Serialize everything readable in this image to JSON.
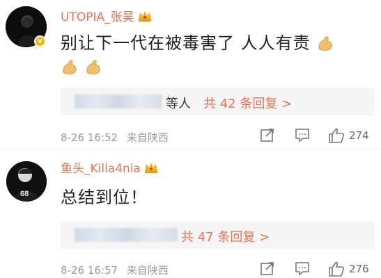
{
  "comments": [
    {
      "username": "UTOPIA_张昊",
      "text": "别让下一代在被毒害了 人人有责",
      "emojis_line1": 1,
      "emojis_line2": 2,
      "reply_preview": {
        "others_label": "等人",
        "reply_link": "共 42 条回复 >"
      },
      "time": "8-26 16:52",
      "source": "来自陕西",
      "likes": "274"
    },
    {
      "username": "鱼头_Killa4nia",
      "text": "总结到位！",
      "reply_preview": {
        "reply_link": "共 47 条回复 >"
      },
      "time": "8-26 16:57",
      "source": "来自陕西",
      "likes": "276"
    }
  ],
  "colors": {
    "username": "#eb7350",
    "text": "#222222",
    "meta": "#9a9a9a",
    "reply_bg": "#f5f5f5",
    "badge": "#f7b500"
  },
  "icons": [
    "verified-badge-icon",
    "crown-icon",
    "flexed-biceps-icon",
    "share-icon",
    "comment-icon",
    "like-icon"
  ]
}
